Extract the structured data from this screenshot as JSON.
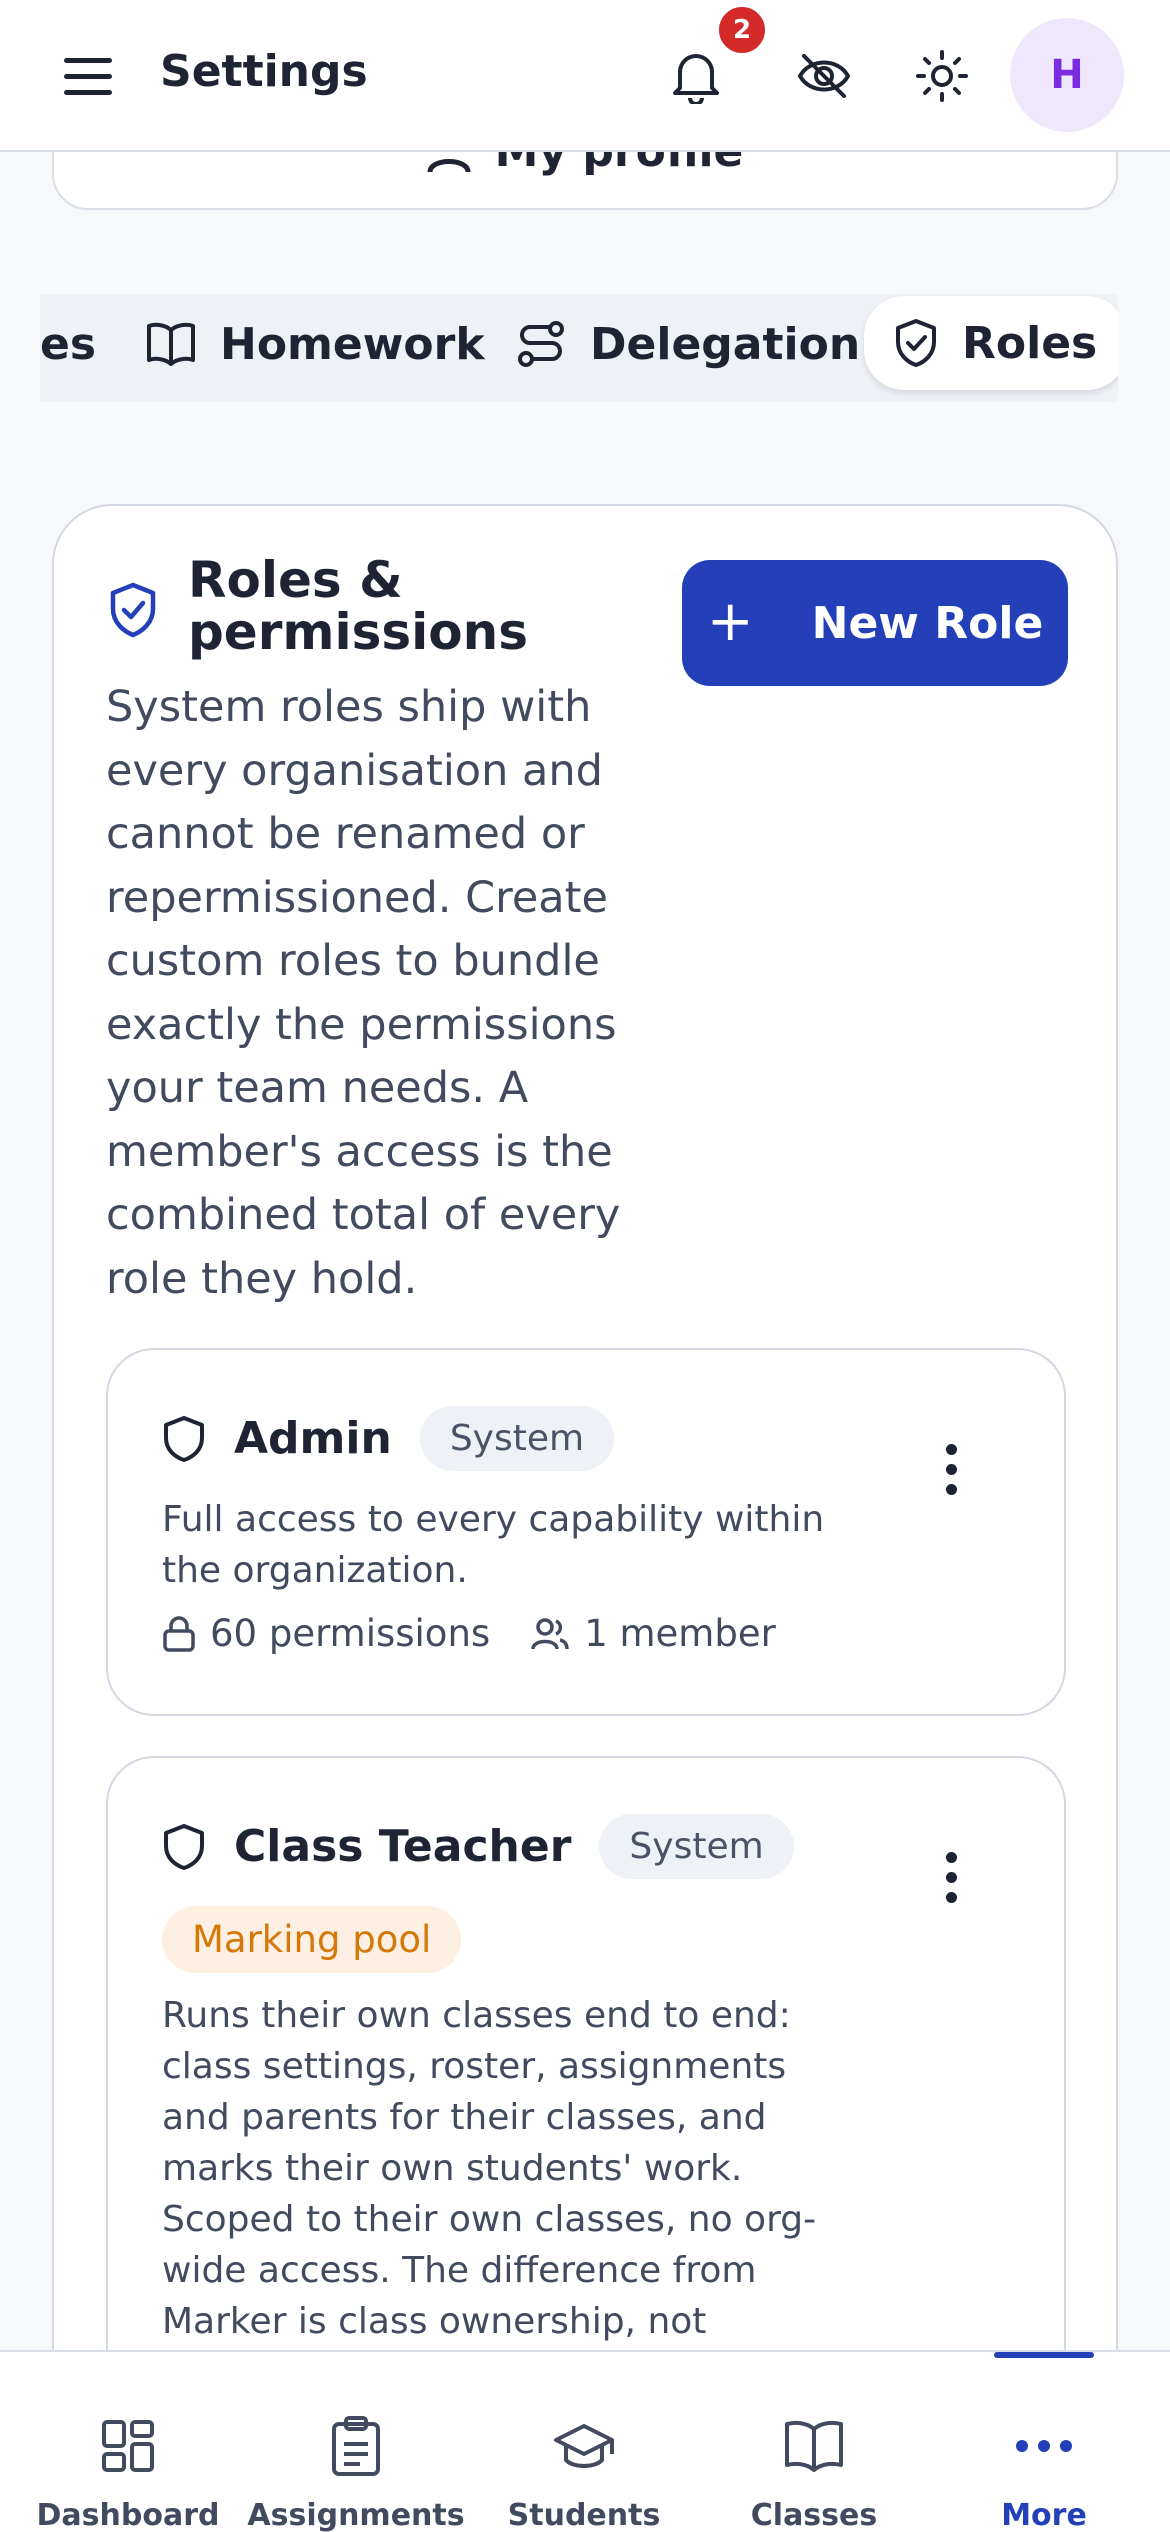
{
  "topbar": {
    "title": "Settings",
    "notification_count": "2",
    "avatar_initial": "H"
  },
  "profile_card": {
    "label": "My profile"
  },
  "tabs": [
    {
      "label": "es",
      "icon": "partial-tab"
    },
    {
      "label": "Homework",
      "icon": "book-icon"
    },
    {
      "label": "Delegation",
      "icon": "route-icon"
    },
    {
      "label": "Roles",
      "icon": "shield-check-icon",
      "active": true
    }
  ],
  "roles_section": {
    "title": "Roles & permissions",
    "new_role_label": "New Role",
    "description": "System roles ship with every organisation and cannot be renamed or repermissioned. Create custom roles to bundle exactly the permissions your team needs. A member's access is the combined total of every role they hold."
  },
  "roles": [
    {
      "name": "Admin",
      "badge": "System",
      "description": "Full access to every capability within the organization.",
      "permissions": "60 permissions",
      "members": "1 member"
    },
    {
      "name": "Class Teacher",
      "badge": "System",
      "tag": "Marking pool",
      "description": "Runs their own classes end to end: class settings, roster, assignments and parents for their classes, and marks their own students' work. Scoped to their own classes, no org-wide access. The difference from Marker is class ownership, not"
    }
  ],
  "bottom_nav": [
    {
      "label": "Dashboard",
      "icon": "grid-icon"
    },
    {
      "label": "Assignments",
      "icon": "clipboard-icon"
    },
    {
      "label": "Students",
      "icon": "graduation-cap-icon"
    },
    {
      "label": "Classes",
      "icon": "book-icon"
    },
    {
      "label": "More",
      "icon": "more-dots-icon",
      "active": true
    }
  ],
  "colors": {
    "primary": "#2340b8",
    "badge_red": "#d42a2a",
    "avatar_purple": "#7c2ce0",
    "pool_orange": "#d4780a"
  }
}
